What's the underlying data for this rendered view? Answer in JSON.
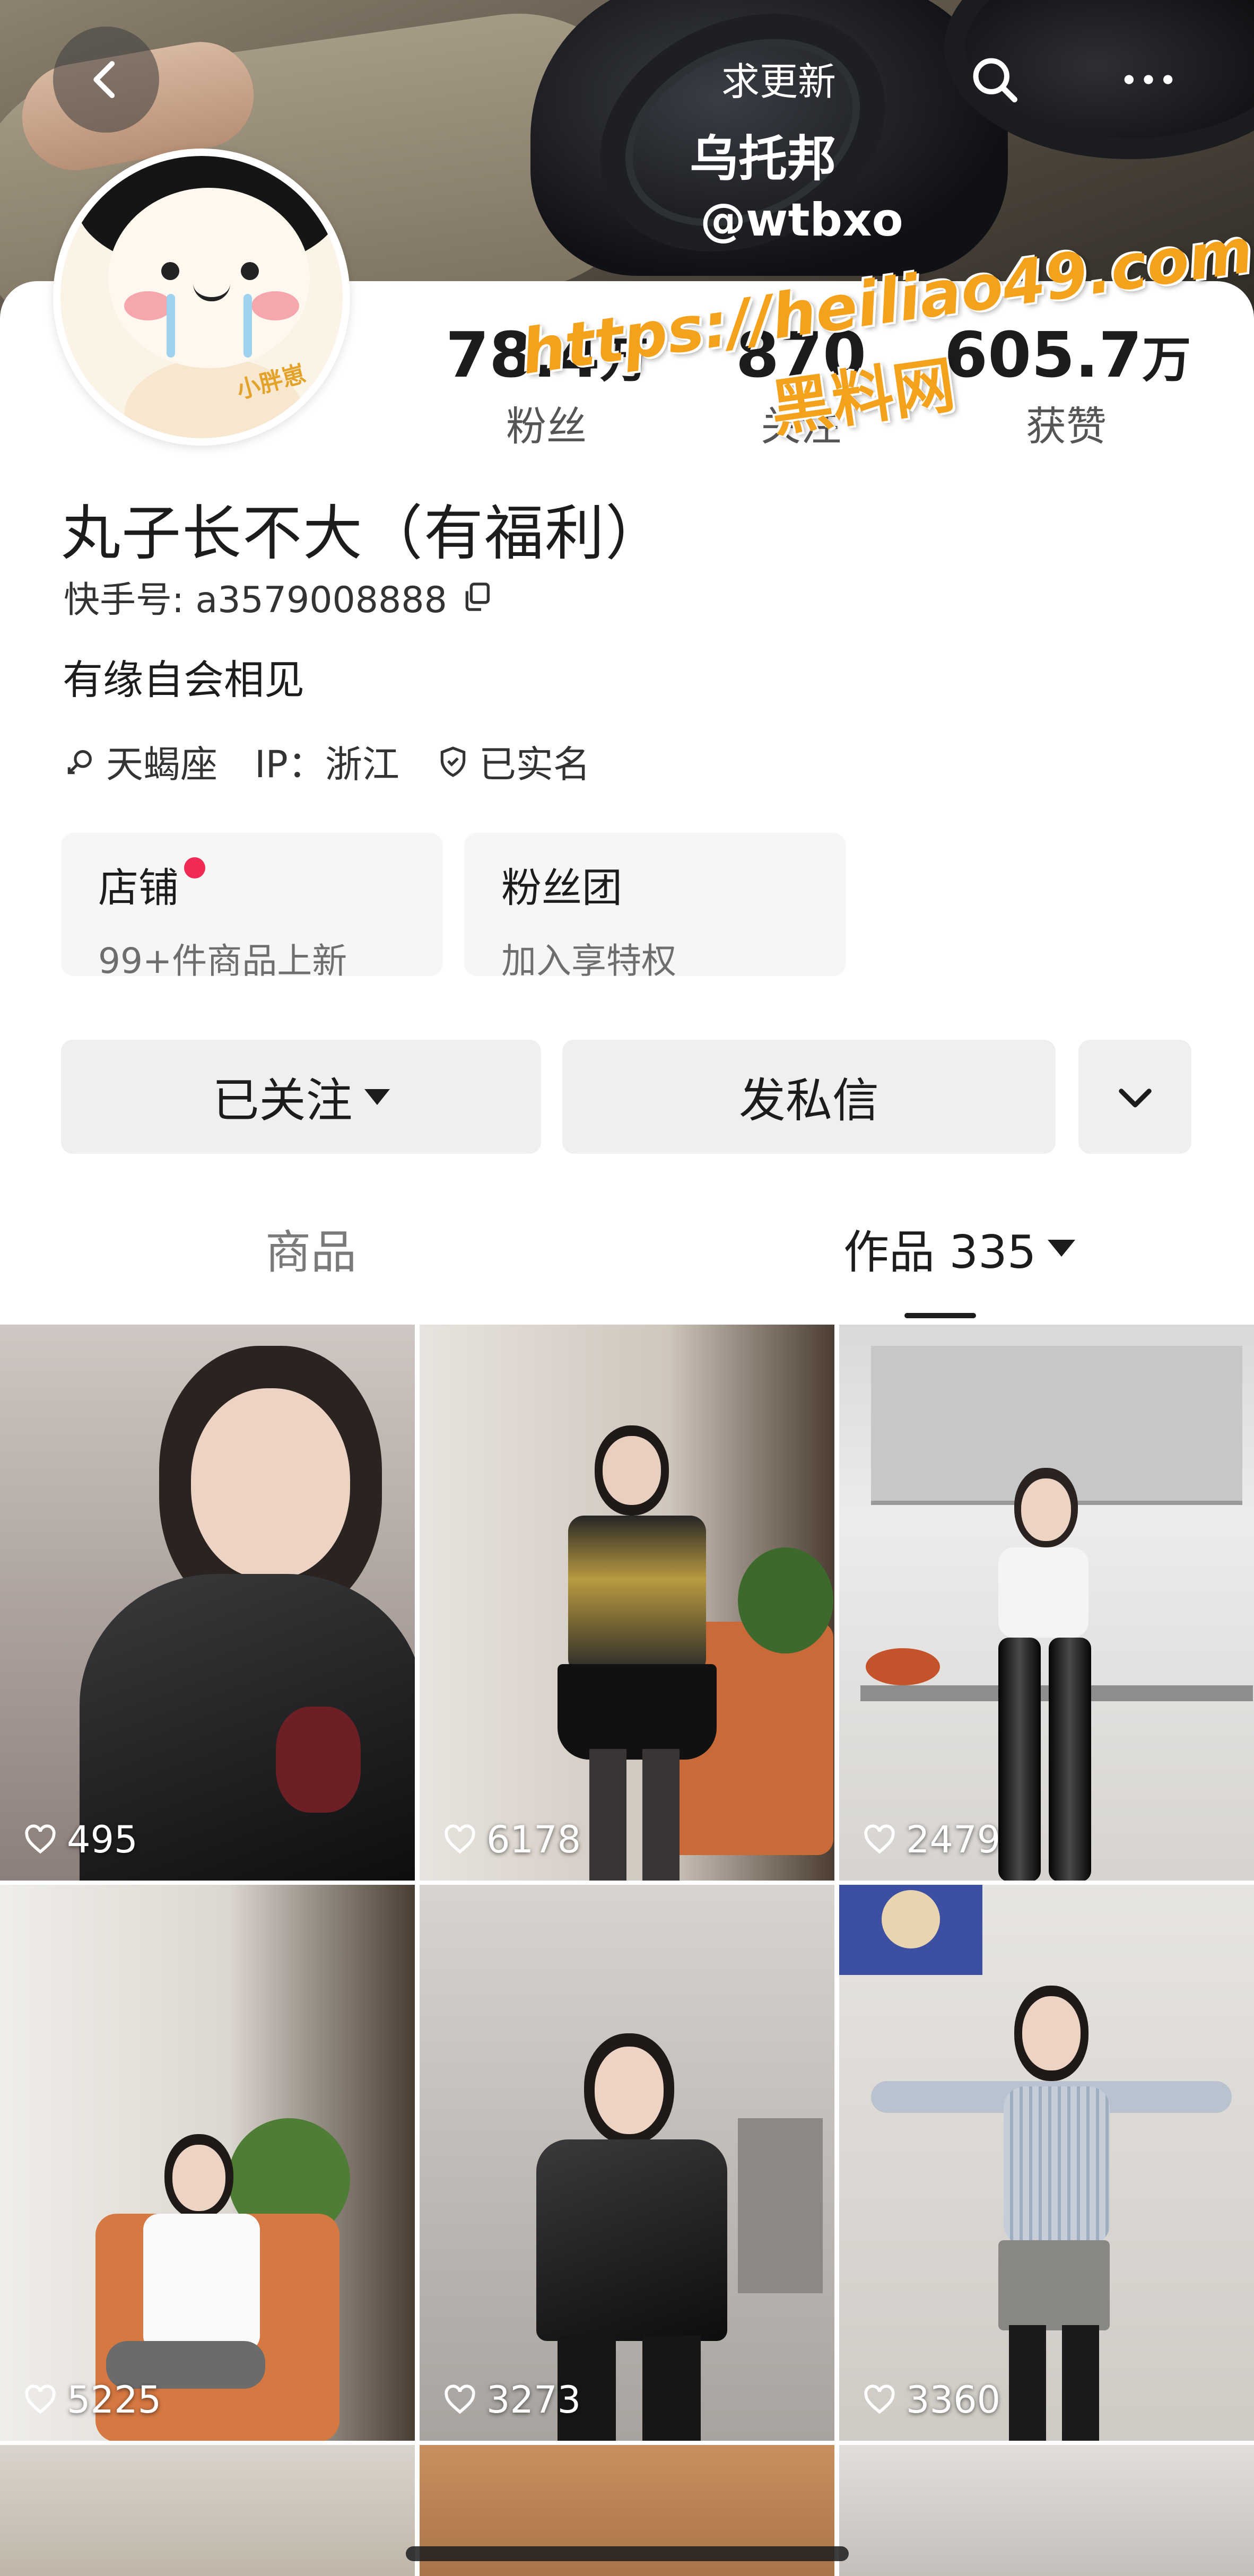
{
  "header": {
    "seek_update_label": "求更新",
    "display_name": "乌托邦",
    "handle": "@wtbxo"
  },
  "stats": {
    "fans": {
      "value": "78.4",
      "unit": "万",
      "label": "粉丝"
    },
    "following": {
      "value": "870",
      "label": "关注"
    },
    "likes": {
      "value": "605.7",
      "unit": "万",
      "label": "获赞"
    }
  },
  "profile": {
    "nickname": "丸子长不大（有福利）",
    "account_id_label": "快手号: a3579008888",
    "bio": "有缘自会相见",
    "avatar_tag": "小胖崽",
    "chips": [
      "天蝎座",
      "IP：浙江",
      "已实名"
    ]
  },
  "watermark": {
    "line1": "https://heiliao49.com",
    "line2": "黑料网"
  },
  "shop": {
    "store": {
      "title": "店铺",
      "subtitle": "99+件商品上新",
      "has_badge": true
    },
    "fan_club": {
      "title": "粉丝团",
      "subtitle": "加入享特权"
    }
  },
  "actions": {
    "follow_label": "已关注",
    "message_label": "发私信"
  },
  "tabs": {
    "products": "商品",
    "works": "作品 335"
  },
  "videos": [
    {
      "likes": "495"
    },
    {
      "likes": "6178"
    },
    {
      "likes": "2479"
    },
    {
      "likes": "5225"
    },
    {
      "likes": "3273"
    },
    {
      "likes": "3360"
    }
  ],
  "icons": [
    "back-arrow-icon",
    "search-icon",
    "more-dots-icon",
    "copy-icon",
    "zodiac-icon",
    "verified-shield-icon",
    "chevron-down-icon",
    "heart-icon"
  ],
  "colors": {
    "accent_badge": "#f02a55",
    "watermark": "#f4a11b",
    "button_bg": "#efefef"
  }
}
